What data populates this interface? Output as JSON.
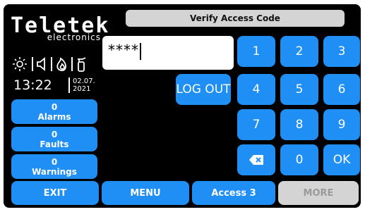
{
  "brand": {
    "logo_text": "Teletek",
    "logo_sub": "electronics"
  },
  "status_icons": [
    "sun-icon",
    "speaker-icon",
    "fire-icon",
    "extinguisher-icon"
  ],
  "clock": {
    "time": "13:22",
    "date_line1": "02.07.",
    "date_line2": "2021"
  },
  "side_buttons": [
    {
      "count": "0",
      "label": "Alarms"
    },
    {
      "count": "0",
      "label": "Faults"
    },
    {
      "count": "0",
      "label": "Warnings"
    }
  ],
  "header": {
    "title": "Verify Access Code"
  },
  "code_input": {
    "value": "****"
  },
  "logout_label": "LOG OUT",
  "keypad": {
    "k1": "1",
    "k2": "2",
    "k3": "3",
    "k4": "4",
    "k5": "5",
    "k6": "6",
    "k7": "7",
    "k8": "8",
    "k9": "9",
    "k0": "0",
    "ok": "OK"
  },
  "bottom_bar": {
    "exit": "EXIT",
    "menu": "MENU",
    "access": "Access 3",
    "more": "MORE"
  },
  "colors": {
    "button_blue": "#1f8ff5",
    "disabled_gray": "#d4d4d4",
    "background": "#000000"
  }
}
